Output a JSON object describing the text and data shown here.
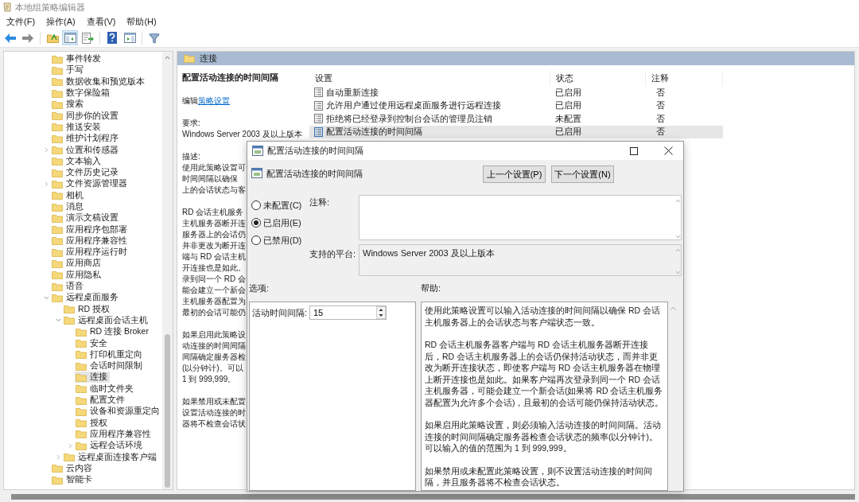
{
  "window": {
    "title": "本地组策略编辑器"
  },
  "menu": [
    "文件(F)",
    "操作(A)",
    "查看(V)",
    "帮助(H)"
  ],
  "toolbar_buttons": [
    {
      "kind": "back",
      "pressed": false
    },
    {
      "kind": "forward",
      "pressed": false
    },
    {
      "kind": "up",
      "pressed": false
    },
    {
      "kind": "tree",
      "pressed": true
    },
    {
      "kind": "export",
      "pressed": false
    },
    {
      "kind": "help",
      "pressed": false
    },
    {
      "kind": "pane",
      "pressed": false
    },
    {
      "kind": "filter",
      "pressed": false
    }
  ],
  "tree": [
    {
      "label": "事件转发",
      "kind": "leaf",
      "selected": false
    },
    {
      "label": "手写",
      "kind": "leaf",
      "selected": false
    },
    {
      "label": "数据收集和预览版本",
      "kind": "leaf",
      "selected": false
    },
    {
      "label": "数字保险箱",
      "kind": "leaf",
      "selected": false
    },
    {
      "label": "搜索",
      "kind": "leaf",
      "selected": false
    },
    {
      "label": "同步你的设置",
      "kind": "leaf",
      "selected": false
    },
    {
      "label": "推送安装",
      "kind": "leaf",
      "selected": false
    },
    {
      "label": "维护计划程序",
      "kind": "leaf",
      "selected": false
    },
    {
      "label": "位置和传感器",
      "kind": "branch",
      "expanded": false,
      "selected": false
    },
    {
      "label": "文本输入",
      "kind": "leaf",
      "selected": false
    },
    {
      "label": "文件历史记录",
      "kind": "leaf",
      "selected": false
    },
    {
      "label": "文件资源管理器",
      "kind": "branch",
      "expanded": false,
      "selected": false
    },
    {
      "label": "相机",
      "kind": "leaf",
      "selected": false
    },
    {
      "label": "消息",
      "kind": "leaf",
      "selected": false
    },
    {
      "label": "演示文稿设置",
      "kind": "leaf",
      "selected": false
    },
    {
      "label": "应用程序包部署",
      "kind": "leaf",
      "selected": false
    },
    {
      "label": "应用程序兼容性",
      "kind": "leaf",
      "selected": false
    },
    {
      "label": "应用程序运行时",
      "kind": "leaf",
      "selected": false
    },
    {
      "label": "应用商店",
      "kind": "leaf",
      "selected": false
    },
    {
      "label": "应用隐私",
      "kind": "leaf",
      "selected": false
    },
    {
      "label": "语音",
      "kind": "leaf",
      "selected": false
    },
    {
      "label": "远程桌面服务",
      "kind": "branch",
      "expanded": true,
      "selected": false,
      "children": [
        {
          "label": "RD 授权",
          "kind": "leaf",
          "selected": false
        },
        {
          "label": "远程桌面会话主机",
          "kind": "branch",
          "expanded": true,
          "selected": false,
          "children": [
            {
              "label": "RD 连接 Broker",
              "kind": "leaf",
              "selected": false
            },
            {
              "label": "安全",
              "kind": "leaf",
              "selected": false
            },
            {
              "label": "打印机重定向",
              "kind": "leaf",
              "selected": false
            },
            {
              "label": "会话时间限制",
              "kind": "leaf",
              "selected": false
            },
            {
              "label": "连接",
              "kind": "leaf",
              "selected": true
            },
            {
              "label": "临时文件夹",
              "kind": "leaf",
              "selected": false
            },
            {
              "label": "配置文件",
              "kind": "leaf",
              "selected": false
            },
            {
              "label": "设备和资源重定向",
              "kind": "leaf",
              "selected": false
            },
            {
              "label": "授权",
              "kind": "leaf",
              "selected": false
            },
            {
              "label": "应用程序兼容性",
              "kind": "leaf",
              "selected": false
            },
            {
              "label": "远程会话环境",
              "kind": "branch",
              "expanded": false,
              "selected": false
            }
          ]
        },
        {
          "label": "远程桌面连接客户端",
          "kind": "branch",
          "expanded": false,
          "selected": false
        }
      ]
    },
    {
      "label": "云内容",
      "kind": "leaf",
      "selected": false
    },
    {
      "label": "智能卡",
      "kind": "leaf",
      "selected": false
    }
  ],
  "pane_header": {
    "title": "连接"
  },
  "details": {
    "title": "配置活动连接的时间间隔",
    "edit_prefix": "编辑",
    "edit_link": "策略设置",
    "requirement_label": "要求:",
    "requirement": "Windows Server 2003 及以上版本",
    "description_label": "描述:",
    "description_paragraphs": [
      [
        "使用此策略设置可",
        "时间间隔以确保",
        "上的会话状态与客"
      ],
      [
        "RD 会话主机服务",
        "主机服务器断开连",
        "服务器上的会话仍",
        "并非更改为断开连",
        "端与 RD 会话主机",
        "开连接也是如此。",
        "录到同一个 RD 会",
        "能会建立一个新会",
        "主机服务器配置为",
        "最初的会话可能仍"
      ],
      [
        "如果启用此策略设",
        "动连接的时间间隔",
        "间隔确定服务器检",
        "(以分钟计)。可以",
        "1 到 999,999。"
      ],
      [
        "如果禁用或未配置",
        "设置活动连接的时",
        "器将不检查会话状"
      ]
    ]
  },
  "settings_list": {
    "columns": [
      "设置",
      "状态",
      "注释"
    ],
    "rows": [
      {
        "name": "自动重新连接",
        "state": "已启用",
        "comment": "否",
        "selected": false
      },
      {
        "name": "允许用户通过使用远程桌面服务进行远程连接",
        "state": "已启用",
        "comment": "否",
        "selected": false
      },
      {
        "name": "拒绝将已经登录到控制台会话的管理员注销",
        "state": "未配置",
        "comment": "否",
        "selected": false
      },
      {
        "name": "配置活动连接的时间间隔",
        "state": "已启用",
        "comment": "否",
        "selected": true
      }
    ]
  },
  "dialog": {
    "title": "配置活动连接的时间间隔",
    "heading": "配置活动连接的时间间隔",
    "buttons": [
      "上一个设置(P)",
      "下一个设置(N)"
    ],
    "states": [
      {
        "label": "未配置(C)",
        "selected": false
      },
      {
        "label": "已启用(E)",
        "selected": true
      },
      {
        "label": "已禁用(D)",
        "selected": false
      }
    ],
    "comment_label": "注释:",
    "platform_label": "支持的平台:",
    "platform": "Windows Server 2003 及以上版本",
    "options_label": "选项:",
    "help_label": "帮助:",
    "option_fields": [
      {
        "label": "活动时间间隔:",
        "value": "15"
      }
    ],
    "help_paragraphs": [
      "使用此策略设置可以输入活动连接的时间间隔以确保 RD 会话主机服务器上的会话状态与客户端状态一致。",
      "RD 会话主机服务器客户端与 RD 会话主机服务器断开连接后，RD 会话主机服务器上的会话仍保持活动状态，而并非更改为断开连接状态，即使客户端与 RD 会话主机服务器在物理上断开连接也是如此。如果客户端再次登录到同一个 RD 会话主机服务器，可能会建立一个新会话(如果将 RD 会话主机服务器配置为允许多个会话)，且最初的会话可能仍保持活动状态。",
      "如果启用此策略设置，则必须输入活动连接的时间间隔。活动连接的时间间隔确定服务器检查会话状态的频率(以分钟计)。可以输入的值的范围为 1 到 999,999。",
      "如果禁用或未配置此策略设置，则不设置活动连接的时间间隔，并且服务器将不检查会话状态。"
    ]
  }
}
